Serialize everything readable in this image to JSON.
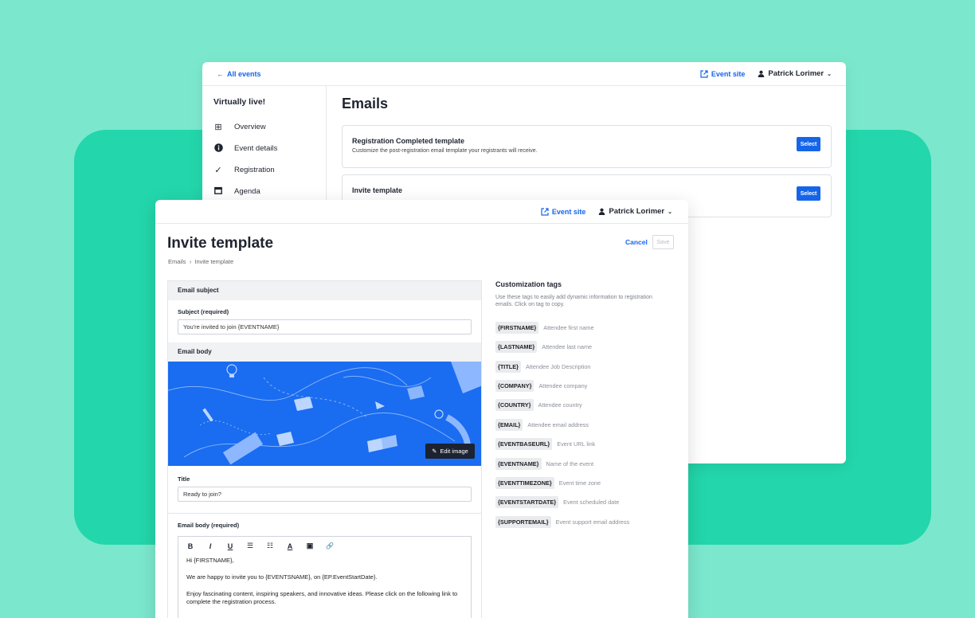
{
  "back_window": {
    "back_link": "All events",
    "event_site": "Event site",
    "user_name": "Patrick Lorimer",
    "event_name": "Virtually live!",
    "nav": [
      {
        "label": "Overview",
        "icon": "grid-icon"
      },
      {
        "label": "Event details",
        "icon": "info-icon"
      },
      {
        "label": "Registration",
        "icon": "check-icon"
      },
      {
        "label": "Agenda",
        "icon": "calendar-icon"
      }
    ],
    "page_title": "Emails",
    "cards": [
      {
        "title": "Registration Completed template",
        "desc": "Customize the post-registration email template your registrants will receive.",
        "button": "Select"
      },
      {
        "title": "Invite template",
        "desc": "",
        "button": "Select"
      }
    ]
  },
  "front_window": {
    "event_site": "Event site",
    "user_name": "Patrick Lorimer",
    "title": "Invite template",
    "breadcrumb": {
      "parent": "Emails",
      "sep": "›",
      "current": "Invite template"
    },
    "cancel": "Cancel",
    "save": "Save",
    "email_subject_heading": "Email subject",
    "subject_label": "Subject (required)",
    "subject_value": "You're invited to join {EVENTNAME}",
    "email_body_heading": "Email body",
    "edit_image": "Edit image",
    "title_label": "Title",
    "title_value": "Ready to join?",
    "body_label": "Email body (required)",
    "toolbar": [
      "B",
      "I",
      "U",
      "☰",
      "☷",
      "A",
      "▣",
      "🔗"
    ],
    "body_paragraphs": [
      "Hi {FIRSTNAME},",
      "We are happy to invite you to {EVENTSNAME}, on {EP.EventStartDate}.",
      "Enjoy fascinating content, inspiring speakers, and innovative ideas. Please click on the following link to complete the registration process."
    ],
    "tags_title": "Customization tags",
    "tags_desc": "Use these tags to easily add dynamic information to registration emails. Click on tag to copy.",
    "tags": [
      {
        "tag": "{FIRSTNAME}",
        "desc": "Attendee first name"
      },
      {
        "tag": "{LASTNAME}",
        "desc": "Attendee last name"
      },
      {
        "tag": "{TITLE}",
        "desc": "Attendee Job Description"
      },
      {
        "tag": "{COMPANY}",
        "desc": "Attendee company"
      },
      {
        "tag": "{COUNTRY}",
        "desc": "Attendee country"
      },
      {
        "tag": "{EMAIL}",
        "desc": "Attendee email address"
      },
      {
        "tag": "{EVENTBASEURL}",
        "desc": "Event URL link"
      },
      {
        "tag": "{EVENTNAME}",
        "desc": "Name of the event"
      },
      {
        "tag": "{EVENTTIMEZONE}",
        "desc": "Event time zone"
      },
      {
        "tag": "{EVENTSTARTDATE}",
        "desc": "Event scheduled date"
      },
      {
        "tag": "{SUPPORTEMAIL}",
        "desc": "Event support email address"
      }
    ]
  },
  "colors": {
    "accent": "#1565e8",
    "background": "#7be8cd",
    "band": "#23d6ab",
    "banner": "#1a6cf0"
  }
}
